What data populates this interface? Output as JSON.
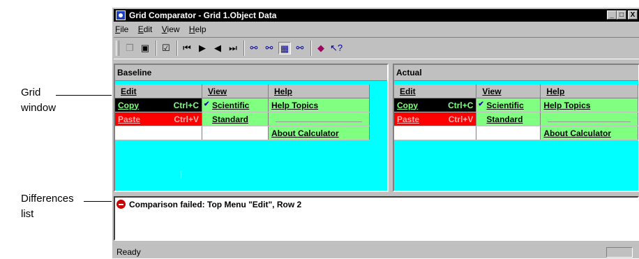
{
  "callouts": {
    "grid_window": [
      "Grid",
      "window"
    ],
    "differences_list": [
      "Differences",
      "list"
    ]
  },
  "window": {
    "title": "Grid Comparator - Grid 1.Object Data",
    "controls": [
      "_",
      "□",
      "X"
    ]
  },
  "menubar": [
    {
      "label": "File",
      "mnemonic": "F",
      "rest": "ile"
    },
    {
      "label": "Edit",
      "mnemonic": "E",
      "rest": "dit"
    },
    {
      "label": "View",
      "mnemonic": "V",
      "rest": "iew"
    },
    {
      "label": "Help",
      "mnemonic": "H",
      "rest": "elp"
    }
  ],
  "toolbar": {
    "icons": [
      "copy-icon",
      "save-icon",
      "properties-icon",
      "first-icon",
      "next-icon",
      "previous-icon",
      "last-icon",
      "compare-icon-1",
      "compare-icon-2",
      "compare-icon-3",
      "compare-icon-4",
      "book-icon",
      "context-help-icon"
    ]
  },
  "baseline": {
    "header": "Baseline",
    "col_headers": [
      "Edit",
      "View",
      "Help"
    ],
    "rows": [
      {
        "edit": "Copy",
        "edit_key": "Ctrl+C",
        "view": "Scientific",
        "help": "Help Topics"
      },
      {
        "edit": "Paste",
        "edit_key": "Ctrl+V",
        "view": "Standard",
        "help": ""
      },
      {
        "edit": "",
        "edit_key": "",
        "view": "",
        "help": "About Calculator"
      }
    ]
  },
  "actual": {
    "header": "Actual",
    "col_headers": [
      "Edit",
      "View",
      "Help"
    ],
    "rows": [
      {
        "edit": "Copy",
        "edit_key": "Ctrl+C",
        "view": "Scientific",
        "help": "Help Topics"
      },
      {
        "edit": "Paste",
        "edit_key": "Ctrl+V",
        "view": "Standard",
        "help": ""
      },
      {
        "edit": "",
        "edit_key": "",
        "view": "",
        "help": "About Calculator"
      }
    ]
  },
  "differences": [
    {
      "text": "Comparison failed: Top Menu \"Edit\", Row 2",
      "status": "failed"
    }
  ],
  "status": {
    "text": "Ready"
  },
  "colors": {
    "grid_background": "#00ffff",
    "match_cell": "#80ff80",
    "selected_cell": "#000000",
    "diff_cell": "#ff0000",
    "fail_icon": "#cc0000"
  }
}
